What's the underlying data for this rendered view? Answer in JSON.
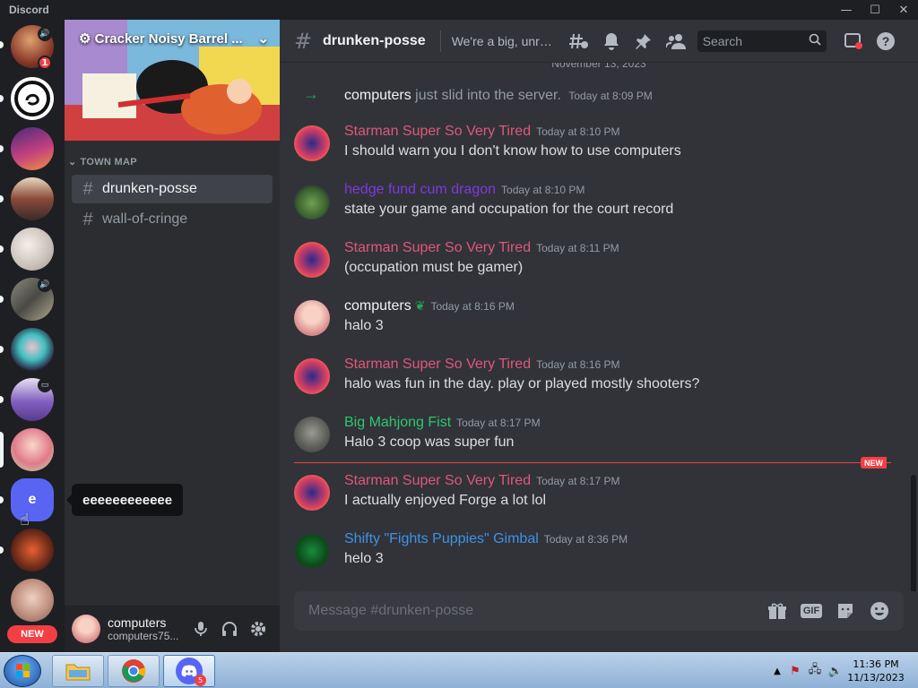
{
  "window": {
    "title": "Discord",
    "minimize": "—",
    "maximize": "☐",
    "close": "✕"
  },
  "servers": [
    {
      "id": "s1",
      "badge": "1"
    },
    {
      "id": "s2"
    },
    {
      "id": "s3"
    },
    {
      "id": "s4"
    },
    {
      "id": "s5"
    },
    {
      "id": "s6"
    },
    {
      "id": "s7"
    },
    {
      "id": "s8"
    },
    {
      "id": "s9",
      "selected": true
    },
    {
      "id": "s10",
      "letter": "e"
    },
    {
      "id": "s11"
    },
    {
      "id": "s12"
    }
  ],
  "rail_new_badge": "NEW",
  "tooltip": "eeeeeeeeeeee",
  "server_header": {
    "name": "Cracker Noisy Barrel ..."
  },
  "category": "TOWN MAP",
  "channels": [
    {
      "name": "drunken-posse",
      "active": true
    },
    {
      "name": "wall-of-cringe",
      "active": false
    }
  ],
  "user": {
    "display_name": "computers",
    "username": "computers75..."
  },
  "channel_header": {
    "name": "drunken-posse",
    "topic": "We're a big, unrul...",
    "search_placeholder": "Search"
  },
  "date_separator": "November 13, 2023",
  "join_message": {
    "user": "computers",
    "text": "just slid into the server.",
    "time": "Today at 8:09 PM"
  },
  "messages": [
    {
      "author": "Starman Super So Very Tired",
      "color": "#e0577a",
      "time": "Today at 8:10 PM",
      "text": "I should warn you I don't know how to use computers"
    },
    {
      "author": "hedge fund cum dragon",
      "color": "#7c3ae0",
      "time": "Today at 8:10 PM",
      "text": "state your game and occupation for the court record"
    },
    {
      "author": "Starman Super So Very Tired",
      "color": "#e0577a",
      "time": "Today at 8:11 PM",
      "text": "(occupation must be gamer)"
    },
    {
      "author": "computers",
      "color": "#f2f3f5",
      "time": "Today at 8:16 PM",
      "text": "halo 3"
    },
    {
      "author": "Starman Super So Very Tired",
      "color": "#e0577a",
      "time": "Today at 8:16 PM",
      "text": "halo was fun in the day. play or played mostly shooters?"
    },
    {
      "author": "Big Mahjong Fist",
      "color": "#2dc770",
      "time": "Today at 8:17 PM",
      "text": "Halo 3 coop was super fun"
    },
    {
      "author": "Starman Super So Very Tired",
      "color": "#e0577a",
      "time": "Today at 8:17 PM",
      "text": "I actually enjoyed Forge a lot lol"
    },
    {
      "author": "Shifty \"Fights Puppies\" Gimbal",
      "color": "#3e92e8",
      "time": "Today at 8:36 PM",
      "text": "helo 3"
    }
  ],
  "new_divider": "NEW",
  "composer": {
    "placeholder": "Message #drunken-posse",
    "gif_label": "GIF"
  },
  "taskbar": {
    "time": "11:36 PM",
    "date": "11/13/2023",
    "discord_badge": "5"
  }
}
